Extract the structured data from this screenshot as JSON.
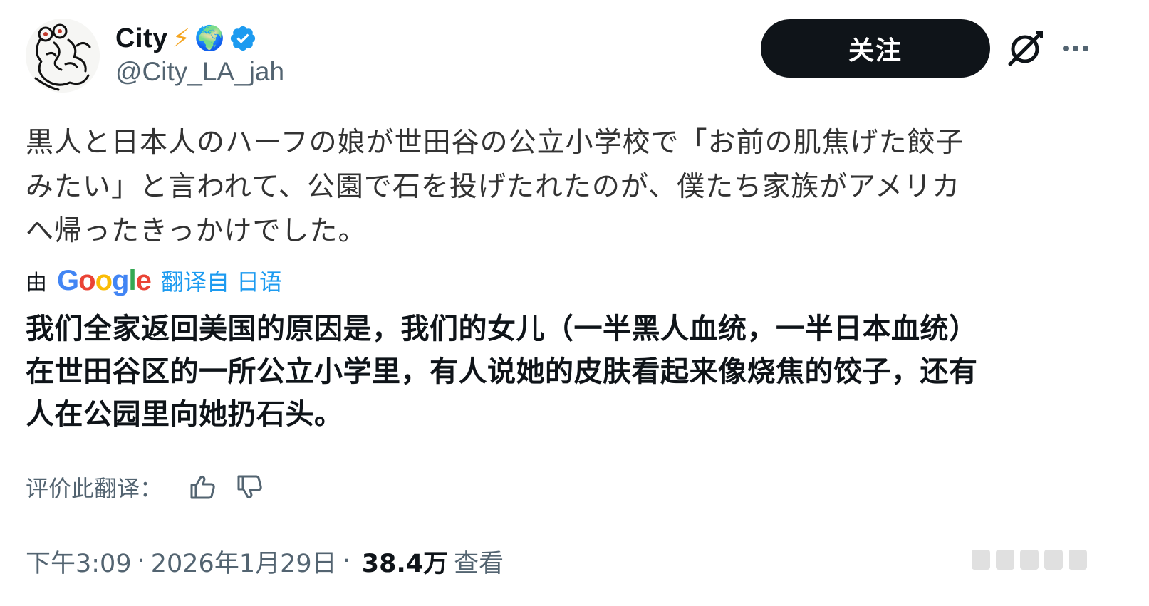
{
  "user": {
    "display_name": "City",
    "handle": "@City_LA_jah",
    "lightning_emoji": "⚡",
    "globe_emoji": "🌍"
  },
  "actions": {
    "follow_label": "关注",
    "more_label": "···"
  },
  "tweet": {
    "original_lines": [
      "黒人と日本人のハーフの娘が世田谷の公立小学校で「お前の肌焦げた餃子",
      "みたい」と言われて、公園で石を投げたれたのが、僕たち家族がアメリカ",
      "へ帰ったきっかけでした。"
    ],
    "translated_by": {
      "prefix": "由",
      "logo_letters": [
        "G",
        "o",
        "o",
        "g",
        "l",
        "e"
      ],
      "link_text": "翻译自 日语"
    },
    "translation_lines": [
      "我们全家返回美国的原因是，我们的女儿（一半黑人血统，一半日本血统）",
      "在世田谷区的一所公立小学里，有人说她的皮肤看起来像烧焦的饺子，还有",
      "人在公园里向她扔石头。"
    ],
    "rate_label": "评价此翻译："
  },
  "meta": {
    "time": "下午3:09",
    "date": "2026年1月29日",
    "views_count": "38.4万",
    "views_label": "查看",
    "separator": "·"
  },
  "colors": {
    "text": "#0f1419",
    "secondary": "#536471",
    "link": "#1d9bf0",
    "follow_bg": "#0f1419",
    "verified": "#1d9bf0",
    "google_blue": "#4285f4",
    "google_red": "#ea4335",
    "google_yellow": "#fbbc05",
    "google_green": "#34a853"
  },
  "icons": [
    "avatar-sketch",
    "verified-badge-icon",
    "grok-icon",
    "more-icon",
    "thumbs-up-icon",
    "thumbs-down-icon"
  ]
}
